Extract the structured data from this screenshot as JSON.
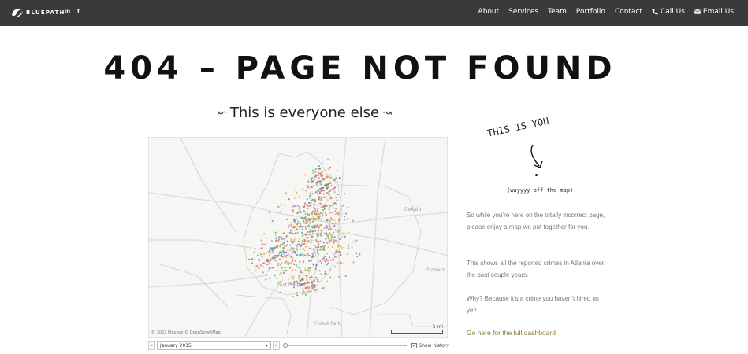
{
  "brand": {
    "name": "BLUEPATH",
    "logo_icon": "bluepath-logo-icon"
  },
  "social": [
    {
      "label": "in",
      "icon": "linkedin-icon"
    },
    {
      "label": "f",
      "icon": "facebook-icon"
    }
  ],
  "nav": {
    "items": [
      {
        "label": "About"
      },
      {
        "label": "Services"
      },
      {
        "label": "Team"
      },
      {
        "label": "Portfolio"
      },
      {
        "label": "Contact"
      },
      {
        "label": "Call Us",
        "icon": "phone-icon"
      },
      {
        "label": "Email Us",
        "icon": "envelope-icon"
      }
    ]
  },
  "page": {
    "title": "404 – PAGE NOT FOUND",
    "everyone_label": "This is everyone else",
    "everyone_arrow_left": "↜",
    "everyone_arrow_right": "↝"
  },
  "map": {
    "attribution": "© 2022 Mapbox © OpenStreetMap",
    "scale_label": "5 mi",
    "places": [
      "DeKalb",
      "East Point",
      "Forest Park",
      "Stonecr"
    ],
    "point_colors": [
      "#4e79a7",
      "#59a14f",
      "#edc948",
      "#f28e2b",
      "#76b7b2",
      "#e15759",
      "#9c755f",
      "#b07aa1"
    ],
    "controls": {
      "prev_label": "‹",
      "next_label": "›",
      "period_value": "January 2015",
      "slider_position": 0,
      "show_history_label": "Show history",
      "show_history_checked": true
    }
  },
  "sidebar": {
    "this_is_you": "THIS IS YOU",
    "way_off": "(wayyyy off the map)",
    "paragraphs": [
      "So while you’re here on the totally incorrect page, please enjoy a map we put together for you.",
      "This shows all the reported crimes in Atlanta over the past couple years.",
      "Why? Because it’s a crime you haven’t hired us yet!"
    ],
    "dashboard_link": "Go here for the full dashboard"
  },
  "colors": {
    "nav_bg": "#3a3a3a",
    "link": "#8b7d3a"
  }
}
